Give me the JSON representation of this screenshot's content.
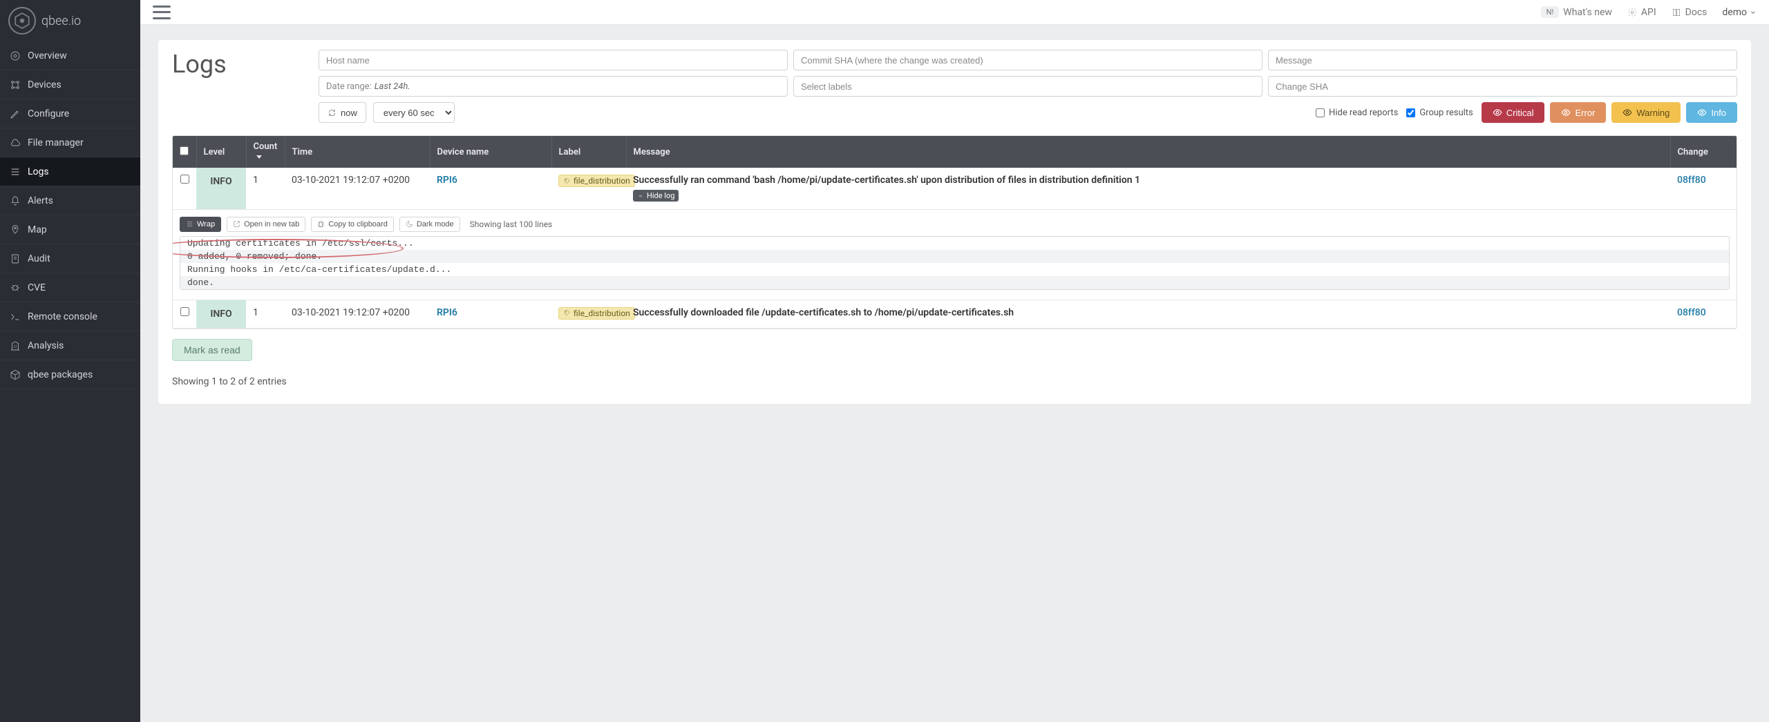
{
  "brand": {
    "name": "qbee.io"
  },
  "topbar": {
    "whats_new_badge": "N!",
    "whats_new": "What's new",
    "api": "API",
    "docs": "Docs",
    "user": "demo"
  },
  "sidebar": {
    "items": [
      {
        "label": "Overview",
        "icon": "home"
      },
      {
        "label": "Devices",
        "icon": "devices"
      },
      {
        "label": "Configure",
        "icon": "edit"
      },
      {
        "label": "File manager",
        "icon": "cloud"
      },
      {
        "label": "Logs",
        "icon": "list",
        "active": true
      },
      {
        "label": "Alerts",
        "icon": "bell"
      },
      {
        "label": "Map",
        "icon": "map"
      },
      {
        "label": "Audit",
        "icon": "shield"
      },
      {
        "label": "CVE",
        "icon": "bug"
      },
      {
        "label": "Remote console",
        "icon": "terminal"
      },
      {
        "label": "Analysis",
        "icon": "building"
      },
      {
        "label": "qbee packages",
        "icon": "package"
      }
    ]
  },
  "page": {
    "title": "Logs",
    "filters": {
      "host_placeholder": "Host name",
      "commit_placeholder": "Commit SHA (where the change was created)",
      "message_placeholder": "Message",
      "date_range_prefix": "Date range: ",
      "date_range_value": "Last 24h.",
      "labels_placeholder": "Select labels",
      "change_sha_placeholder": "Change SHA",
      "now_btn": "now",
      "refresh_select": "every 60 sec",
      "hide_read_label": "Hide read reports",
      "hide_read_checked": false,
      "group_results_label": "Group results",
      "group_results_checked": true,
      "level_buttons": {
        "critical": "Critical",
        "error": "Error",
        "warning": "Warning",
        "info": "Info"
      }
    },
    "columns": {
      "level": "Level",
      "count": "Count",
      "time": "Time",
      "device": "Device name",
      "label": "Label",
      "message": "Message",
      "change": "Change"
    },
    "rows": [
      {
        "level": "INFO",
        "count": "1",
        "time": "03-10-2021 19:12:07 +0200",
        "device": "RPI6",
        "label": "file_distribution",
        "message": "Successfully ran command 'bash /home/pi/update-certificates.sh' upon distribution of files in distribution definition 1",
        "change": "08ff80",
        "hide_log_label": "Hide log"
      },
      {
        "level": "INFO",
        "count": "1",
        "time": "03-10-2021 19:12:07 +0200",
        "device": "RPI6",
        "label": "file_distribution",
        "message": "Successfully downloaded file /update-certificates.sh to /home/pi/update-certificates.sh",
        "change": "08ff80"
      }
    ],
    "log_panel": {
      "wrap": "Wrap",
      "open_tab": "Open in new tab",
      "copy": "Copy to clipboard",
      "dark": "Dark mode",
      "showing": "Showing last 100 lines",
      "lines": [
        "Updating certificates in /etc/ssl/certs...",
        "0 added, 0 removed; done.",
        "Running hooks in /etc/ca-certificates/update.d...",
        "done."
      ]
    },
    "mark_as_read": "Mark as read",
    "entries_info": "Showing 1 to 2 of 2 entries"
  },
  "colors": {
    "critical": "#b73a49",
    "error": "#e0905f",
    "warning": "#f2c14e",
    "info": "#5fb6e0",
    "link": "#1f7aa6",
    "annotation": "#d26a6f"
  }
}
